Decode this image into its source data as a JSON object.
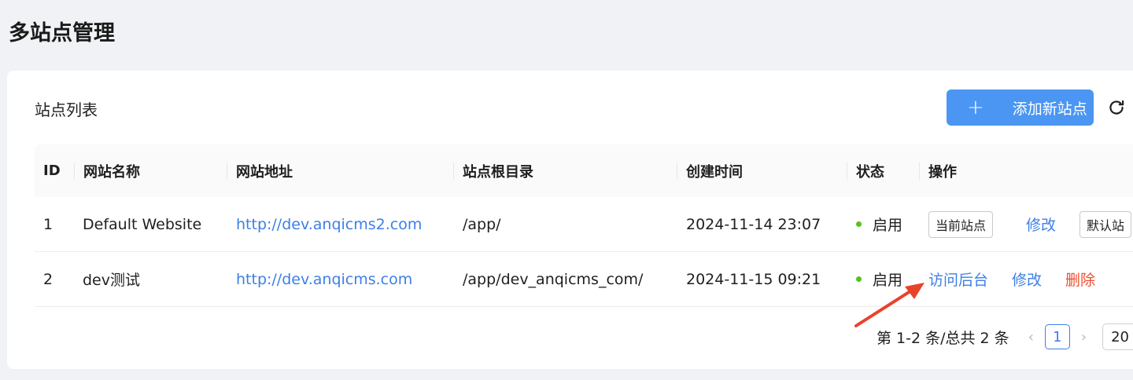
{
  "page": {
    "title": "多站点管理"
  },
  "card": {
    "title": "站点列表",
    "add_button": "添加新站点",
    "add_icon": "plus-icon",
    "reload_icon": "reload-icon"
  },
  "table": {
    "headers": [
      "ID",
      "网站名称",
      "网站地址",
      "站点根目录",
      "创建时间",
      "状态",
      "操作"
    ],
    "rows": [
      {
        "id": "1",
        "name": "Default Website",
        "url": "http://dev.anqicms2.com",
        "root": "/app/",
        "created": "2024-11-14 23:07",
        "status": "启用",
        "actions": [
          "当前站点",
          "修改",
          "默认站"
        ]
      },
      {
        "id": "2",
        "name": "dev测试",
        "url": "http://dev.anqicms.com",
        "root": "/app/dev_anqicms_com/",
        "created": "2024-11-15 09:21",
        "status": "启用",
        "actions": [
          "访问后台",
          "修改",
          "删除"
        ]
      }
    ]
  },
  "pagination": {
    "summary": "第 1-2 条/总共 2 条",
    "prev": "‹",
    "current": "1",
    "next": "›",
    "page_size": "20"
  },
  "colors": {
    "primary": "#4a96f2",
    "link": "#3d7fe6",
    "danger": "#f04d2e",
    "success": "#52c41a",
    "annotation": "#e8432a"
  }
}
